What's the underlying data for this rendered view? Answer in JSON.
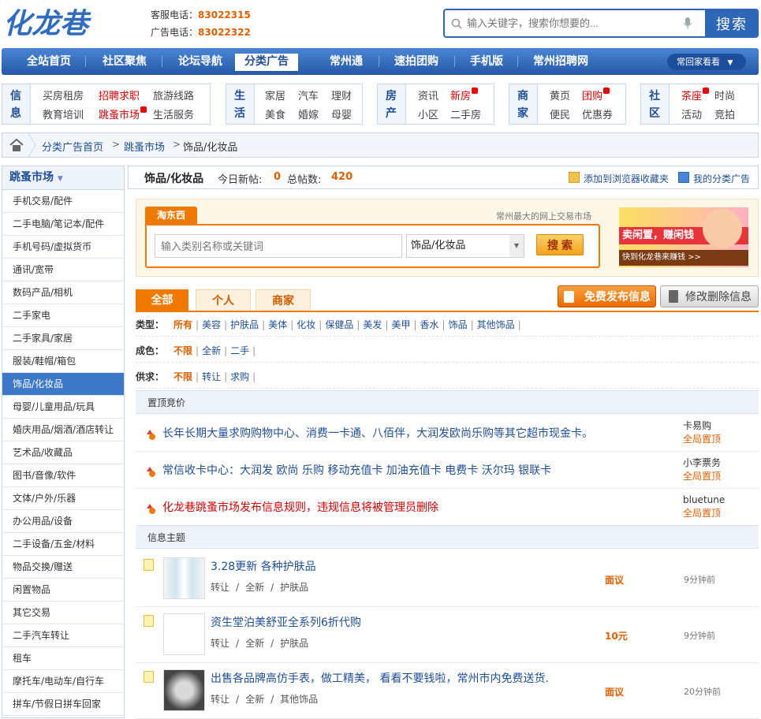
{
  "header": {
    "logo_text": "化龙巷",
    "phones": [
      {
        "label": "客服电话：",
        "number": "83022315"
      },
      {
        "label": "广告电话：",
        "number": "83022322"
      }
    ],
    "search_placeholder": "输入关键字，搜索你想要的...",
    "search_button": "搜索"
  },
  "nav": {
    "items": [
      "全站首页",
      "社区聚焦",
      "论坛导航",
      "分类广告",
      "常州通",
      "速拍团购",
      "手机版",
      "常州招聘网"
    ],
    "active": "分类广告",
    "city_button": "常回家看看"
  },
  "channels": [
    {
      "title": "信息",
      "links": [
        [
          "买房租房",
          "招聘求职",
          "旅游线路"
        ],
        [
          "教育培训",
          "跳蚤市场",
          "生活服务"
        ]
      ]
    },
    {
      "title": "生活",
      "links": [
        [
          "家居",
          "汽车",
          "理财"
        ],
        [
          "美食",
          "婚嫁",
          "母婴"
        ]
      ]
    },
    {
      "title": "房产",
      "links": [
        [
          "资讯",
          "新房"
        ],
        [
          "小区",
          "二手房"
        ]
      ]
    },
    {
      "title": "商家",
      "links": [
        [
          "黄页",
          "团购"
        ],
        [
          "便民",
          "优惠券"
        ]
      ]
    },
    {
      "title": "社区",
      "links": [
        [
          "茶座",
          "时尚"
        ],
        [
          "活动",
          "竞拍"
        ]
      ]
    }
  ],
  "breadcrumb": [
    "分类广告首页",
    "跳蚤市场",
    "饰品/化妆品"
  ],
  "sidebar": {
    "title": "跳蚤市场",
    "items": [
      "手机交易/配件",
      "二手电脑/笔记本/配件",
      "手机号码/虚拟货币",
      "通讯/宽带",
      "数码产品/相机",
      "二手家电",
      "二手家具/家居",
      "服装/鞋帽/箱包",
      "饰品/化妆品",
      "母婴/儿童用品/玩具",
      "婚庆用品/烟酒/酒店转让",
      "艺术品/收藏品",
      "图书/音像/软件",
      "文体/户外/乐器",
      "办公用品/设备",
      "二手设备/五金/材料",
      "物品交换/赠送",
      "闲置物品",
      "其它交易",
      "二手汽车转让",
      "租车",
      "摩托车/电动车/自行车",
      "拼车/节假日拼车回家"
    ],
    "active": "饰品/化妆品"
  },
  "main_head": {
    "category": "饰品/化妆品",
    "today_label": "今日新帖:",
    "today_count": "0",
    "total_label": "总帖数:",
    "total_count": "420",
    "bookmark": "添加到浏览器收藏夹",
    "my_ads": "我的分类广告"
  },
  "promo": {
    "tab": "淘东西",
    "slogan": "常州最大的网上交易市场",
    "input_placeholder": "输入类别名称或关键词",
    "select_value": "饰品/化妆品",
    "button": "搜 索",
    "banner_line1": "卖闲置，赚闲钱",
    "banner_line2": "快到化龙巷来赚钱 >>"
  },
  "tabs": [
    "全部",
    "个人",
    "商家"
  ],
  "actions": {
    "publish": "免费发布信息",
    "edit": "修改删除信息"
  },
  "filters": [
    {
      "label": "类型：",
      "options": [
        "所有",
        "美容",
        "护肤品",
        "美体",
        "化妆",
        "保健品",
        "美发",
        "美甲",
        "香水",
        "饰品",
        "其他饰品"
      ]
    },
    {
      "label": "成色：",
      "options": [
        "不限",
        "全新",
        "二手"
      ]
    },
    {
      "label": "供求：",
      "options": [
        "不限",
        "转让",
        "求购"
      ]
    }
  ],
  "top_section_title": "置顶竞价",
  "top_items": [
    {
      "title": "长年长期大量求购购物中心、消费一卡通、八佰伴，大润发欧尚乐购等其它超市现金卡。",
      "user": "卡易购",
      "scope": "全局置顶",
      "color": "#1e4e96"
    },
    {
      "title": "常信收卡中心：大润发 欧尚 乐购 移动充值卡 加油充值卡 电费卡 沃尔玛 银联卡",
      "user": "小李票务",
      "scope": "全局置顶",
      "color": "#1e4e96"
    },
    {
      "title": "化龙巷跳蚤市场发布信息规则，违规信息将被管理员删除",
      "user": "bluetune",
      "scope": "全局置顶",
      "color": "#d00000"
    }
  ],
  "list_section_title": "信息主题",
  "list_items": [
    {
      "title": "3.28更新 各种护肤品",
      "meta": [
        "转让",
        "全新",
        "护肤品"
      ],
      "price": "面议",
      "time": "9分钟前"
    },
    {
      "title": "资生堂泊美舒亚全系列6折代购",
      "meta": [
        "转让",
        "全新",
        "护肤品"
      ],
      "price": "10元",
      "time": "9分钟前"
    },
    {
      "title": "出售各品牌高仿手表，做工精美， 看看不要钱啦，常州市内免费送货.",
      "meta": [
        "转让",
        "全新",
        "其他饰品"
      ],
      "price": "面议",
      "time": "20分钟前"
    }
  ]
}
